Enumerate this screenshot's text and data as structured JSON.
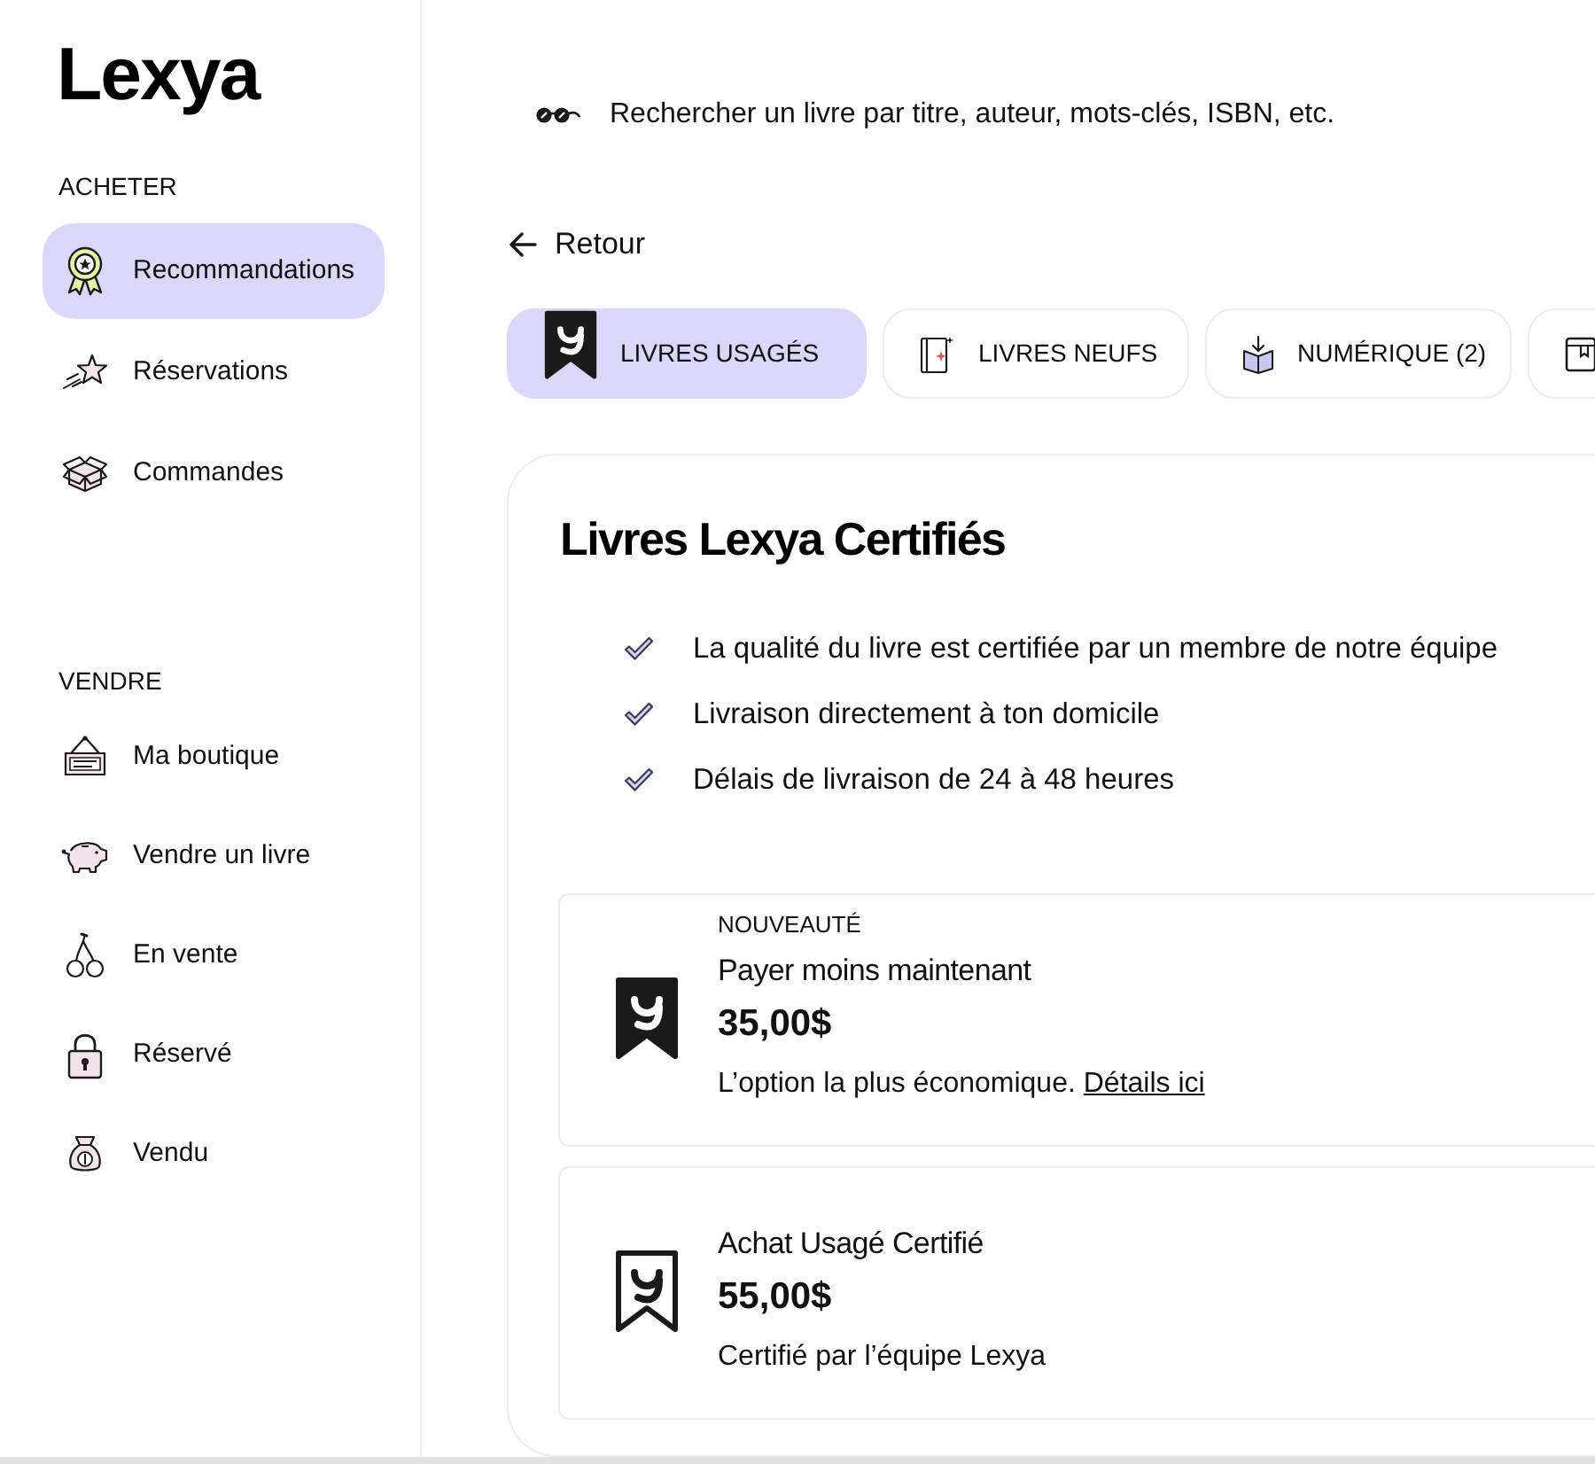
{
  "logo": "Lexya",
  "sidebar": {
    "sections": [
      {
        "title": "ACHETER",
        "items": [
          {
            "label": "Recommandations",
            "selected": true
          },
          {
            "label": "Réservations",
            "selected": false
          },
          {
            "label": "Commandes",
            "selected": false
          }
        ]
      },
      {
        "title": "VENDRE",
        "items": [
          {
            "label": "Ma boutique",
            "selected": false
          },
          {
            "label": "Vendre un livre",
            "selected": false
          },
          {
            "label": "En vente",
            "selected": false
          },
          {
            "label": "Réservé",
            "selected": false
          },
          {
            "label": "Vendu",
            "selected": false
          }
        ]
      }
    ]
  },
  "search": {
    "placeholder": "Rechercher un livre par titre, auteur, mots-clés, ISBN, etc."
  },
  "back_link": "Retour",
  "tabs": [
    {
      "label": "LIVRES USAGÉS",
      "selected": true
    },
    {
      "label": "LIVRES NEUFS",
      "selected": false
    },
    {
      "label": "NUMÉRIQUE (2)",
      "selected": false
    },
    {
      "selected": false
    }
  ],
  "panel": {
    "title": "Livres Lexya Certifiés",
    "features": [
      "La qualité du livre est certifiée par un membre de notre équipe",
      "Livraison directement à ton domicile",
      "Délais de livraison de 24 à 48 heures"
    ],
    "options": [
      {
        "kind": "filled",
        "tag": "NOUVEAUTÉ",
        "title": "Payer moins maintenant",
        "price": "35,00$",
        "description": "L’option la plus économique.",
        "link": "Détails ici"
      },
      {
        "kind": "outline",
        "title": "Achat Usagé Certifié",
        "price": "55,00$",
        "description": "Certifié par l’équipe Lexya"
      }
    ]
  }
}
